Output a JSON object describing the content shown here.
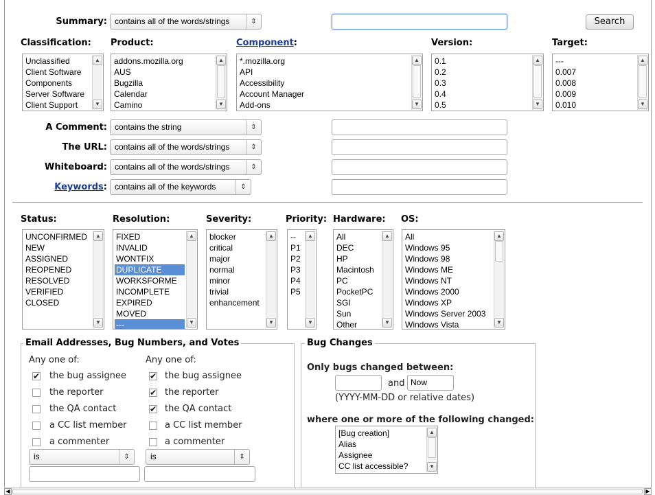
{
  "search_row": {
    "summary_label": "Summary:",
    "summary_operator": "contains all of the words/strings",
    "summary_value": "",
    "search_button": "Search"
  },
  "lists_top": {
    "classification": {
      "label": "Classification:",
      "items": [
        "Unclassified",
        "Client Software",
        "Components",
        "Server Software",
        "Client Support"
      ]
    },
    "product": {
      "label": "Product:",
      "items": [
        "addons.mozilla.org",
        "AUS",
        "Bugzilla",
        "Calendar",
        "Camino"
      ]
    },
    "component": {
      "label": "Component",
      "items": [
        "*.mozilla.org",
        "API",
        "Accessibility",
        "Account Manager",
        "Add-ons"
      ]
    },
    "version": {
      "label": "Version:",
      "items": [
        "0.1",
        "0.2",
        "0.3",
        "0.4",
        "0.5"
      ]
    },
    "target": {
      "label": "Target:",
      "items": [
        "---",
        "0.007",
        "0.008",
        "0.009",
        "0.010"
      ]
    }
  },
  "text_fields": [
    {
      "label": "A Comment:",
      "operator": "contains the string",
      "value": ""
    },
    {
      "label": "The URL:",
      "operator": "contains all of the words/strings",
      "value": ""
    },
    {
      "label": "Whiteboard:",
      "operator": "contains all of the words/strings",
      "value": ""
    },
    {
      "label": "Keywords",
      "operator": "contains all of the keywords",
      "value": ""
    }
  ],
  "lists_mid": {
    "status": {
      "label": "Status:",
      "items": [
        "UNCONFIRMED",
        "NEW",
        "ASSIGNED",
        "REOPENED",
        "RESOLVED",
        "VERIFIED",
        "CLOSED"
      ]
    },
    "resolution": {
      "label": "Resolution:",
      "items": [
        "FIXED",
        "INVALID",
        "WONTFIX",
        "DUPLICATE",
        "WORKSFORME",
        "INCOMPLETE",
        "EXPIRED",
        "MOVED",
        "---"
      ],
      "selected": [
        "DUPLICATE",
        "---"
      ]
    },
    "severity": {
      "label": "Severity:",
      "items": [
        "blocker",
        "critical",
        "major",
        "normal",
        "minor",
        "trivial",
        "enhancement"
      ]
    },
    "priority": {
      "label": "Priority:",
      "items": [
        "--",
        "P1",
        "P2",
        "P3",
        "P4",
        "P5"
      ]
    },
    "hardware": {
      "label": "Hardware:",
      "items": [
        "All",
        "DEC",
        "HP",
        "Macintosh",
        "PC",
        "PocketPC",
        "SGI",
        "Sun",
        "Other"
      ]
    },
    "os": {
      "label": "OS:",
      "items": [
        "All",
        "Windows 95",
        "Windows 98",
        "Windows ME",
        "Windows NT",
        "Windows 2000",
        "Windows XP",
        "Windows Server 2003",
        "Windows Vista"
      ]
    }
  },
  "email_section": {
    "legend": "Email Addresses, Bug Numbers, and Votes",
    "col1": {
      "heading": "Any one of:",
      "options": [
        {
          "label": "the bug assignee",
          "checked": true
        },
        {
          "label": "the reporter",
          "checked": false
        },
        {
          "label": "the QA contact",
          "checked": false
        },
        {
          "label": "a CC list member",
          "checked": false
        },
        {
          "label": "a commenter",
          "checked": false
        }
      ],
      "operator": "is",
      "value": ""
    },
    "col2": {
      "heading": "Any one of:",
      "options": [
        {
          "label": "the bug assignee",
          "checked": true
        },
        {
          "label": "the reporter",
          "checked": true
        },
        {
          "label": "the QA contact",
          "checked": true
        },
        {
          "label": "a CC list member",
          "checked": false
        },
        {
          "label": "a commenter",
          "checked": false
        }
      ],
      "operator": "is",
      "value": ""
    }
  },
  "bug_changes": {
    "legend": "Bug Changes",
    "between_label": "Only bugs changed between:",
    "from_value": "",
    "and_label": "and",
    "to_value": "Now",
    "hint": "(YYYY-MM-DD or relative dates)",
    "where_label": "where one or more of the following changed:",
    "fields": [
      "[Bug creation]",
      "Alias",
      "Assignee",
      "CC list accessible?"
    ]
  },
  "colors": {
    "link": "#1a3c95",
    "selection": "#5a8fd6",
    "focus_border": "#5b86c8"
  }
}
